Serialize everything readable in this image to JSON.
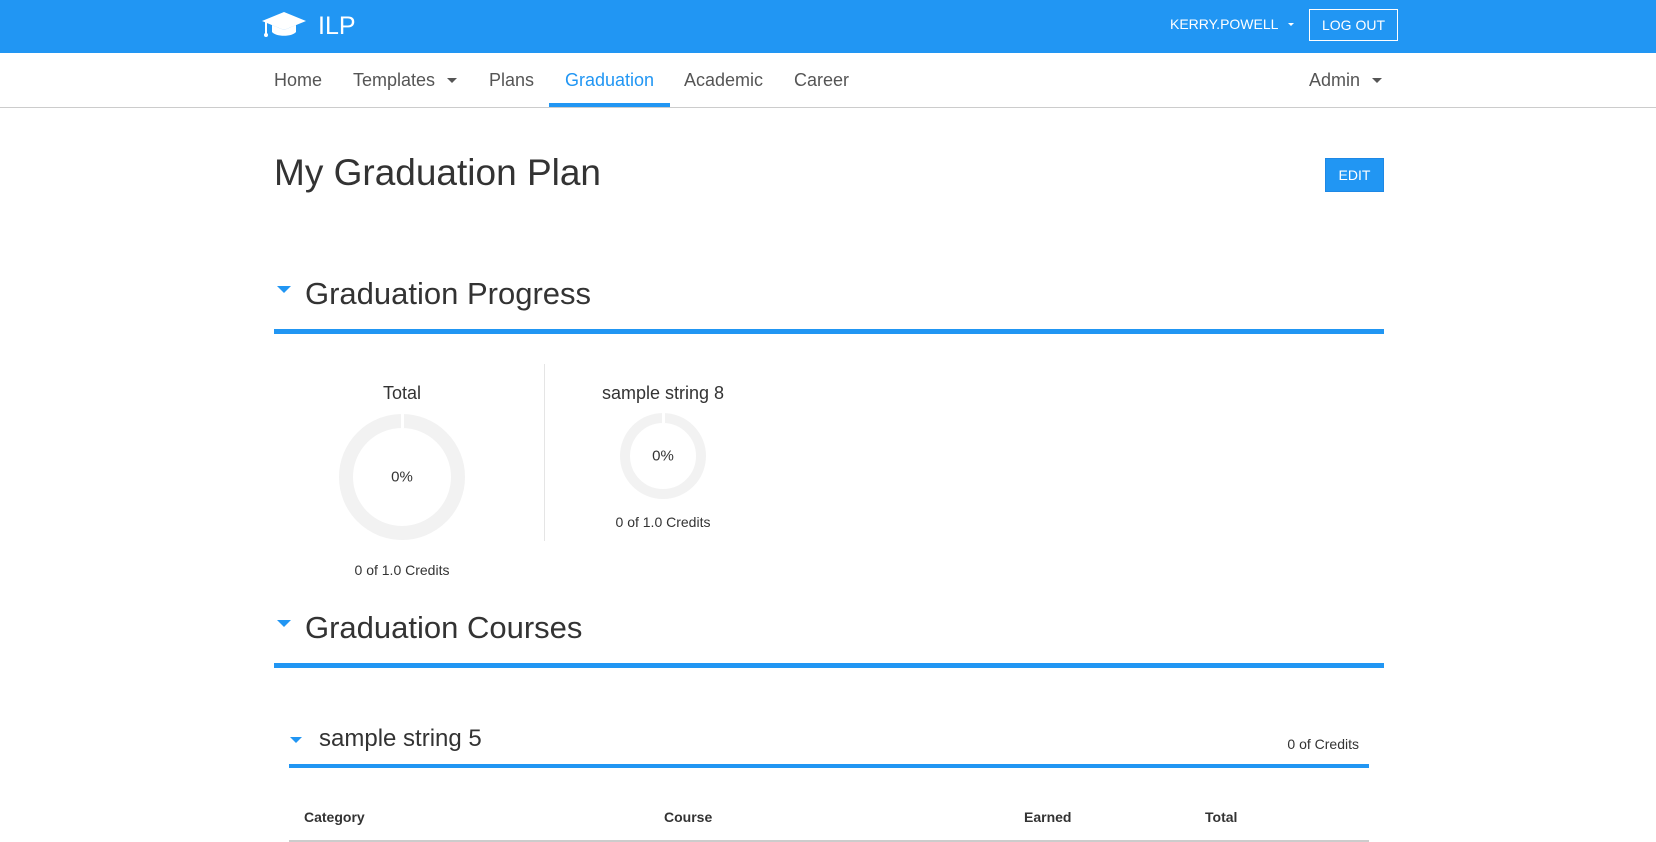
{
  "header": {
    "brand": "ILP",
    "user": "KERRY.POWELL",
    "logout_label": "LOG OUT",
    "colors": {
      "primary": "#2196f3"
    }
  },
  "nav": {
    "items": [
      {
        "label": "Home"
      },
      {
        "label": "Templates"
      },
      {
        "label": "Plans"
      },
      {
        "label": "Graduation"
      },
      {
        "label": "Academic"
      },
      {
        "label": "Career"
      }
    ],
    "admin_label": "Admin",
    "active": "Graduation"
  },
  "page": {
    "title": "My Graduation Plan",
    "edit_label": "EDIT"
  },
  "progress_section": {
    "title": "Graduation Progress",
    "items": [
      {
        "label": "Total",
        "percent_text": "0%",
        "percent": 0,
        "credits_text": "0 of 1.0 Credits"
      },
      {
        "label": "sample string 8",
        "percent_text": "0%",
        "percent": 0,
        "credits_text": "0 of 1.0 Credits"
      }
    ]
  },
  "courses_section": {
    "title": "Graduation Courses",
    "group": {
      "title": "sample string 5",
      "credits_text": "0 of Credits",
      "columns": [
        "Category",
        "Course",
        "Earned",
        "Total"
      ]
    }
  }
}
